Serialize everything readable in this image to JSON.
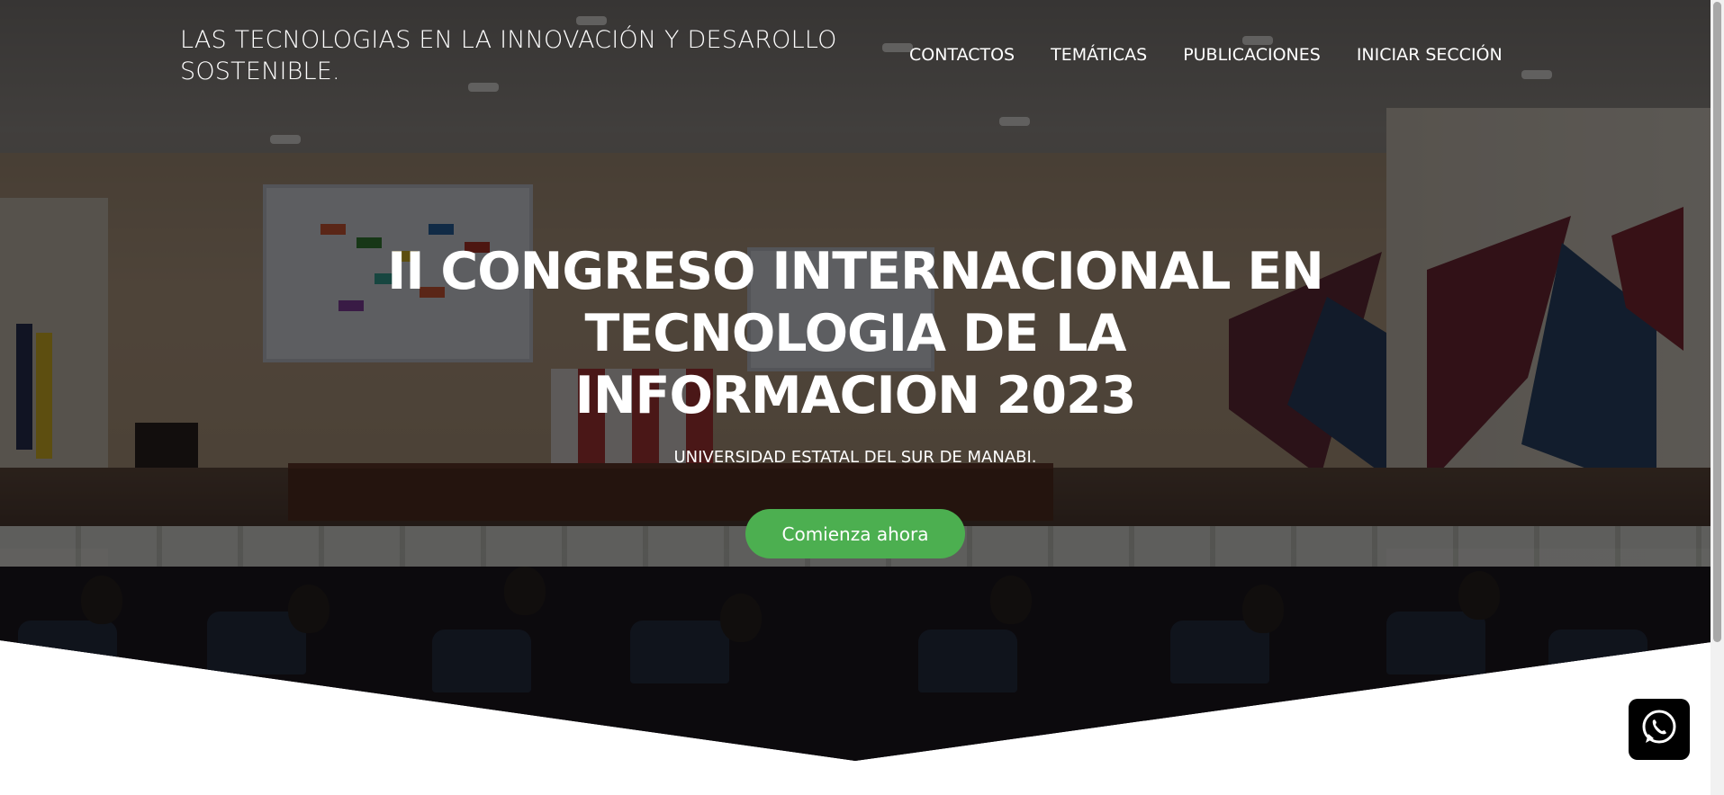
{
  "header": {
    "site_title": "LAS TECNOLOGIAS EN LA INNOVACIÓN Y DESAROLLO SOSTENIBLE.",
    "nav": [
      {
        "label": "CONTACTOS"
      },
      {
        "label": "TEMÁTICAS"
      },
      {
        "label": "PUBLICACIONES"
      },
      {
        "label": "INICIAR SECCIÓN"
      }
    ]
  },
  "hero": {
    "background_image": "conference-auditorium-photo",
    "title": "II CONGRESO INTERNACIONAL EN TECNOLOGIA DE LA INFORMACION 2023",
    "subtitle": "UNIVERSIDAD ESTATAL DEL SUR DE MANABI.",
    "cta_label": "Comienza ahora",
    "cta_color": "#4caf50",
    "overlay_color": "#000000"
  },
  "floating": {
    "whatsapp_icon": "whatsapp-icon",
    "whatsapp_bg": "#000000"
  }
}
